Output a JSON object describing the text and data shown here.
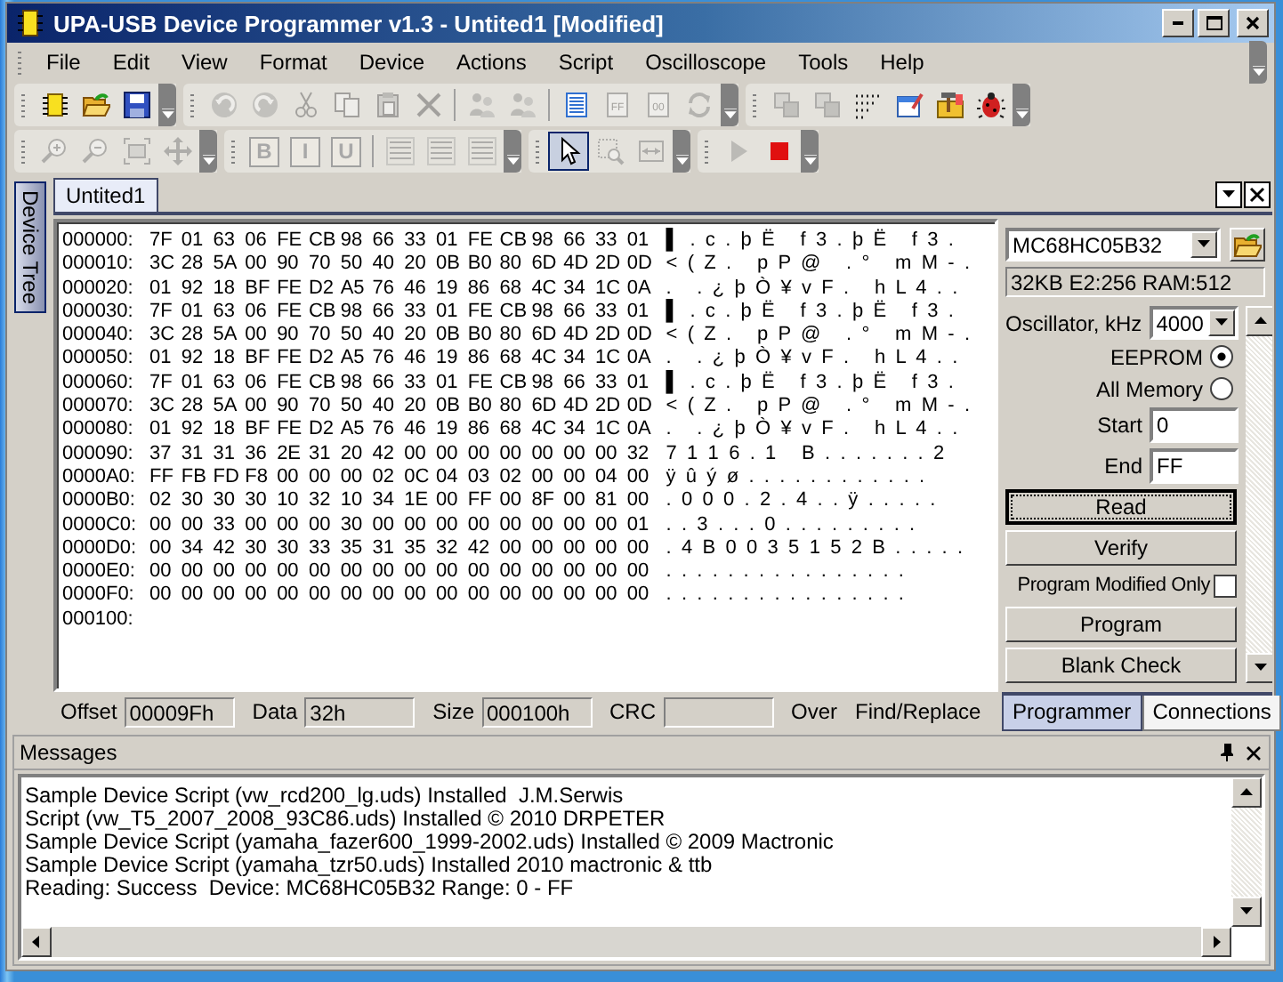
{
  "window": {
    "title": "UPA-USB Device Programmer v1.3 - Untited1 [Modified]"
  },
  "menu": [
    "File",
    "Edit",
    "View",
    "Format",
    "Device",
    "Actions",
    "Script",
    "Oscilloscope",
    "Tools",
    "Help"
  ],
  "toolbars": [
    [
      [
        {
          "kind": "chip",
          "disabled": false
        },
        {
          "kind": "open",
          "disabled": false
        },
        {
          "kind": "save",
          "disabled": false
        }
      ],
      [
        {
          "kind": "undo",
          "disabled": true
        },
        {
          "kind": "redo",
          "disabled": true
        },
        {
          "kind": "cut",
          "disabled": true
        },
        {
          "kind": "copy",
          "disabled": true
        },
        {
          "kind": "paste",
          "disabled": true
        },
        {
          "kind": "delete",
          "disabled": true
        },
        {
          "kind": "separator"
        },
        {
          "kind": "users",
          "disabled": true
        },
        {
          "kind": "users",
          "disabled": true
        },
        {
          "kind": "separator"
        },
        {
          "kind": "document",
          "disabled": false
        },
        {
          "kind": "labeled-doc",
          "label": "FF",
          "disabled": true
        },
        {
          "kind": "labeled-doc",
          "label": "00",
          "disabled": true
        },
        {
          "kind": "refresh",
          "disabled": true
        }
      ],
      [
        {
          "kind": "squares",
          "disabled": true
        },
        {
          "kind": "squares",
          "disabled": true
        },
        {
          "kind": "dots",
          "disabled": false
        },
        {
          "kind": "window",
          "disabled": false
        },
        {
          "kind": "toolbox",
          "disabled": false
        },
        {
          "kind": "bug",
          "disabled": false
        }
      ]
    ],
    [
      [
        {
          "kind": "zoom-in",
          "disabled": true
        },
        {
          "kind": "zoom-out",
          "disabled": true
        },
        {
          "kind": "fit",
          "disabled": true
        },
        {
          "kind": "move",
          "disabled": true
        }
      ],
      [
        {
          "kind": "letter",
          "label": "B",
          "disabled": true
        },
        {
          "kind": "letter",
          "label": "I",
          "disabled": true
        },
        {
          "kind": "letter",
          "label": "U",
          "disabled": true
        },
        {
          "kind": "separator"
        },
        {
          "kind": "align",
          "disabled": true
        },
        {
          "kind": "align",
          "disabled": true
        },
        {
          "kind": "align",
          "disabled": true
        }
      ],
      [
        {
          "kind": "pointer",
          "disabled": false,
          "selected": true
        },
        {
          "kind": "zoom-rect",
          "disabled": true,
          "selected": false
        },
        {
          "kind": "fit-width",
          "disabled": true,
          "selected": false
        }
      ],
      [
        {
          "kind": "play",
          "disabled": true
        },
        {
          "kind": "stop",
          "disabled": false
        }
      ]
    ]
  ],
  "side_tab": "Device Tree",
  "document_tabs": [
    {
      "label": "Untited1",
      "selected": true
    }
  ],
  "hex_rows": [
    {
      "address": "000000:",
      "bytes": [
        "7F",
        "01",
        "63",
        "06",
        "FE",
        "CB",
        "98",
        "66",
        "33",
        "01",
        "FE",
        "CB",
        "98",
        "66",
        "33",
        "01"
      ],
      "ascii": "▌ . c . þ Ë   f 3 . þ Ë   f 3 ."
    },
    {
      "address": "000010:",
      "bytes": [
        "3C",
        "28",
        "5A",
        "00",
        "90",
        "70",
        "50",
        "40",
        "20",
        "0B",
        "B0",
        "80",
        "6D",
        "4D",
        "2D",
        "0D"
      ],
      "ascii": "< ( Z .   p P @   . °   m M - ."
    },
    {
      "address": "000020:",
      "bytes": [
        "01",
        "92",
        "18",
        "BF",
        "FE",
        "D2",
        "A5",
        "76",
        "46",
        "19",
        "86",
        "68",
        "4C",
        "34",
        "1C",
        "0A"
      ],
      "ascii": ".   . ¿ þ Ò ¥ v F .   h L 4 . ."
    },
    {
      "address": "000030:",
      "bytes": [
        "7F",
        "01",
        "63",
        "06",
        "FE",
        "CB",
        "98",
        "66",
        "33",
        "01",
        "FE",
        "CB",
        "98",
        "66",
        "33",
        "01"
      ],
      "ascii": "▌ . c . þ Ë   f 3 . þ Ë   f 3 ."
    },
    {
      "address": "000040:",
      "bytes": [
        "3C",
        "28",
        "5A",
        "00",
        "90",
        "70",
        "50",
        "40",
        "20",
        "0B",
        "B0",
        "80",
        "6D",
        "4D",
        "2D",
        "0D"
      ],
      "ascii": "< ( Z .   p P @   . °   m M - ."
    },
    {
      "address": "000050:",
      "bytes": [
        "01",
        "92",
        "18",
        "BF",
        "FE",
        "D2",
        "A5",
        "76",
        "46",
        "19",
        "86",
        "68",
        "4C",
        "34",
        "1C",
        "0A"
      ],
      "ascii": ".   . ¿ þ Ò ¥ v F .   h L 4 . ."
    },
    {
      "address": "000060:",
      "bytes": [
        "7F",
        "01",
        "63",
        "06",
        "FE",
        "CB",
        "98",
        "66",
        "33",
        "01",
        "FE",
        "CB",
        "98",
        "66",
        "33",
        "01"
      ],
      "ascii": "▌ . c . þ Ë   f 3 . þ Ë   f 3 ."
    },
    {
      "address": "000070:",
      "bytes": [
        "3C",
        "28",
        "5A",
        "00",
        "90",
        "70",
        "50",
        "40",
        "20",
        "0B",
        "B0",
        "80",
        "6D",
        "4D",
        "2D",
        "0D"
      ],
      "ascii": "< ( Z .   p P @   . °   m M - ."
    },
    {
      "address": "000080:",
      "bytes": [
        "01",
        "92",
        "18",
        "BF",
        "FE",
        "D2",
        "A5",
        "76",
        "46",
        "19",
        "86",
        "68",
        "4C",
        "34",
        "1C",
        "0A"
      ],
      "ascii": ".   . ¿ þ Ò ¥ v F .   h L 4 . ."
    },
    {
      "address": "000090:",
      "bytes": [
        "37",
        "31",
        "31",
        "36",
        "2E",
        "31",
        "20",
        "42",
        "00",
        "00",
        "00",
        "00",
        "00",
        "00",
        "00",
        "32"
      ],
      "ascii": "7 1 1 6 . 1   B . . . . . . . 2"
    },
    {
      "address": "0000A0:",
      "bytes": [
        "FF",
        "FB",
        "FD",
        "F8",
        "00",
        "00",
        "00",
        "02",
        "0C",
        "04",
        "03",
        "02",
        "00",
        "00",
        "04",
        "00"
      ],
      "ascii": "ÿ û ý ø . . . . . . . . . . . ."
    },
    {
      "address": "0000B0:",
      "bytes": [
        "02",
        "30",
        "30",
        "30",
        "10",
        "32",
        "10",
        "34",
        "1E",
        "00",
        "FF",
        "00",
        "8F",
        "00",
        "81",
        "00"
      ],
      "ascii": ". 0 0 0 . 2 . 4 . . ÿ . . . . ."
    },
    {
      "address": "0000C0:",
      "bytes": [
        "00",
        "00",
        "33",
        "00",
        "00",
        "00",
        "30",
        "00",
        "00",
        "00",
        "00",
        "00",
        "00",
        "00",
        "00",
        "01"
      ],
      "ascii": ". . 3 . . . 0 . . . . . . . . ."
    },
    {
      "address": "0000D0:",
      "bytes": [
        "00",
        "34",
        "42",
        "30",
        "30",
        "33",
        "35",
        "31",
        "35",
        "32",
        "42",
        "00",
        "00",
        "00",
        "00",
        "00"
      ],
      "ascii": ". 4 B 0 0 3 5 1 5 2 B . . . . ."
    },
    {
      "address": "0000E0:",
      "bytes": [
        "00",
        "00",
        "00",
        "00",
        "00",
        "00",
        "00",
        "00",
        "00",
        "00",
        "00",
        "00",
        "00",
        "00",
        "00",
        "00"
      ],
      "ascii": ". . . . . . . . . . . . . . . ."
    },
    {
      "address": "0000F0:",
      "bytes": [
        "00",
        "00",
        "00",
        "00",
        "00",
        "00",
        "00",
        "00",
        "00",
        "00",
        "00",
        "00",
        "00",
        "00",
        "00",
        "00"
      ],
      "ascii": ". . . . . . . . . . . . . . . ."
    },
    {
      "address": "000100:"
    }
  ],
  "programmer": {
    "device": "MC68HC05B32",
    "info": "32KB E2:256 RAM:512",
    "oscillator": {
      "label": "Oscillator, kHz",
      "value": "4000"
    },
    "memory": [
      {
        "label": "EEPROM",
        "selected": true
      },
      {
        "label": "All Memory",
        "selected": false
      }
    ],
    "range": [
      {
        "label": "Start",
        "value": "0"
      },
      {
        "label": "End",
        "value": "FF"
      }
    ],
    "actions": [
      {
        "kind": "button",
        "label": "Read",
        "focused": true
      },
      {
        "kind": "button",
        "label": "Verify",
        "focused": false
      },
      {
        "kind": "checkbox",
        "label": "Program Modified Only",
        "checked": false
      },
      {
        "kind": "button",
        "label": "Program",
        "focused": false
      },
      {
        "kind": "button",
        "label": "Blank Check",
        "focused": false
      }
    ]
  },
  "panel_tabs": [
    {
      "label": "Programmer",
      "selected": true
    },
    {
      "label": "Connections",
      "selected": false
    }
  ],
  "status": {
    "fields": [
      {
        "label": "Offset",
        "value": "00009Fh"
      },
      {
        "label": "Data",
        "value": "32h"
      },
      {
        "label": "Size",
        "value": "000100h"
      },
      {
        "label": "CRC"
      }
    ],
    "indicators": [
      "Over",
      "Find/Replace"
    ]
  },
  "messages": {
    "title": "Messages",
    "lines": [
      "Sample Device Script (vw_rcd200_lg.uds) Installed  J.M.Serwis",
      "Script (vw_T5_2007_2008_93C86.uds) Installed © 2010 DRPETER",
      "Sample Device Script (yamaha_fazer600_1999-2002.uds) Installed © 2009 Mactronic",
      "Sample Device Script (yamaha_tzr50.uds) Installed 2010 mactronic & ttb",
      "Reading: Success  Device: MC68HC05B32 Range: 0 - FF"
    ]
  }
}
